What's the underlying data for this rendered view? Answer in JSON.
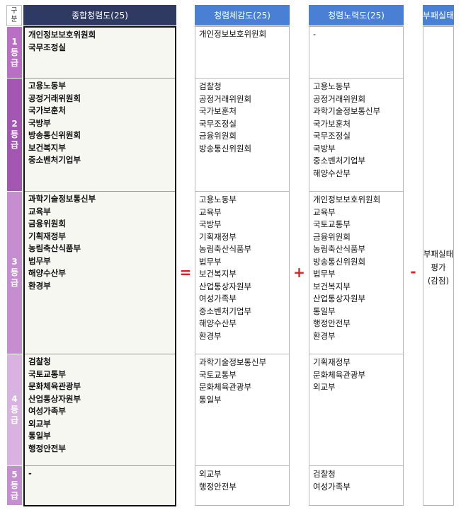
{
  "headers": {
    "gubun": [
      "구",
      "분"
    ],
    "overall": "종합청렴도(25)",
    "internal": "청렴체감도(25)",
    "effort": "청렴노력도(25)",
    "corruption": "부패실태"
  },
  "grades": [
    {
      "chars": [
        "1",
        "등",
        "급"
      ],
      "color": "#b86fc4"
    },
    {
      "chars": [
        "2",
        "등",
        "급"
      ],
      "color": "#a456b3"
    },
    {
      "chars": [
        "3",
        "등",
        "급"
      ],
      "color": "#c48ed0"
    },
    {
      "chars": [
        "4",
        "등",
        "급"
      ],
      "color": "#d8b3e0"
    },
    {
      "chars": [
        "5",
        "등",
        "급"
      ],
      "color": "#c48ed0"
    }
  ],
  "overall": [
    [
      "개인정보보호위원회",
      "국무조정실"
    ],
    [
      "고용노동부",
      "공정거래위원회",
      "국가보훈처",
      "국방부",
      "방송통신위원회",
      "보건복지부",
      "중소벤처기업부"
    ],
    [
      "과학기술정보통신부",
      "교육부",
      "금융위원회",
      "기획재정부",
      "농림축산식품부",
      "법무부",
      "해양수산부",
      "환경부"
    ],
    [
      "검찰청",
      "국토교통부",
      "문화체육관광부",
      "산업통상자원부",
      "여성가족부",
      "외교부",
      "통일부",
      "행정안전부"
    ],
    [
      "-"
    ]
  ],
  "internal": [
    [
      "개인정보보호위원회"
    ],
    [
      "검찰청",
      "공정거래위원회",
      "국가보훈처",
      "국무조정실",
      "금융위원회",
      "방송통신위원회"
    ],
    [
      "고용노동부",
      "교육부",
      "국방부",
      "기획재정부",
      "농림축산식품부",
      "법무부",
      "보건복지부",
      "산업통상자원부",
      "여성가족부",
      "중소벤처기업부",
      "해양수산부",
      "환경부"
    ],
    [
      "과학기술정보통신부",
      "국토교통부",
      "문화체육관광부",
      "통일부"
    ],
    [
      "외교부",
      "행정안전부"
    ]
  ],
  "effort": [
    [
      "-"
    ],
    [
      "고용노동부",
      "공정거래위원회",
      "과학기술정보통신부",
      "국가보훈처",
      "국무조정실",
      "국방부",
      "중소벤처기업부",
      "해양수산부"
    ],
    [
      "개인정보보호위원회",
      "교육부",
      "국토교통부",
      "금융위원회",
      "농림축산식품부",
      "방송통신위원회",
      "법무부",
      "보건복지부",
      "산업통상자원부",
      "통일부",
      "행정안전부",
      "환경부"
    ],
    [
      "기획재정부",
      "문화체육관광부",
      "외교부"
    ],
    [
      "검찰청",
      "여성가족부"
    ]
  ],
  "operators": {
    "equals": "=",
    "plus": "+",
    "minus": "-"
  },
  "corruption_eval": [
    "부패실태",
    "평가",
    "(감점)"
  ]
}
